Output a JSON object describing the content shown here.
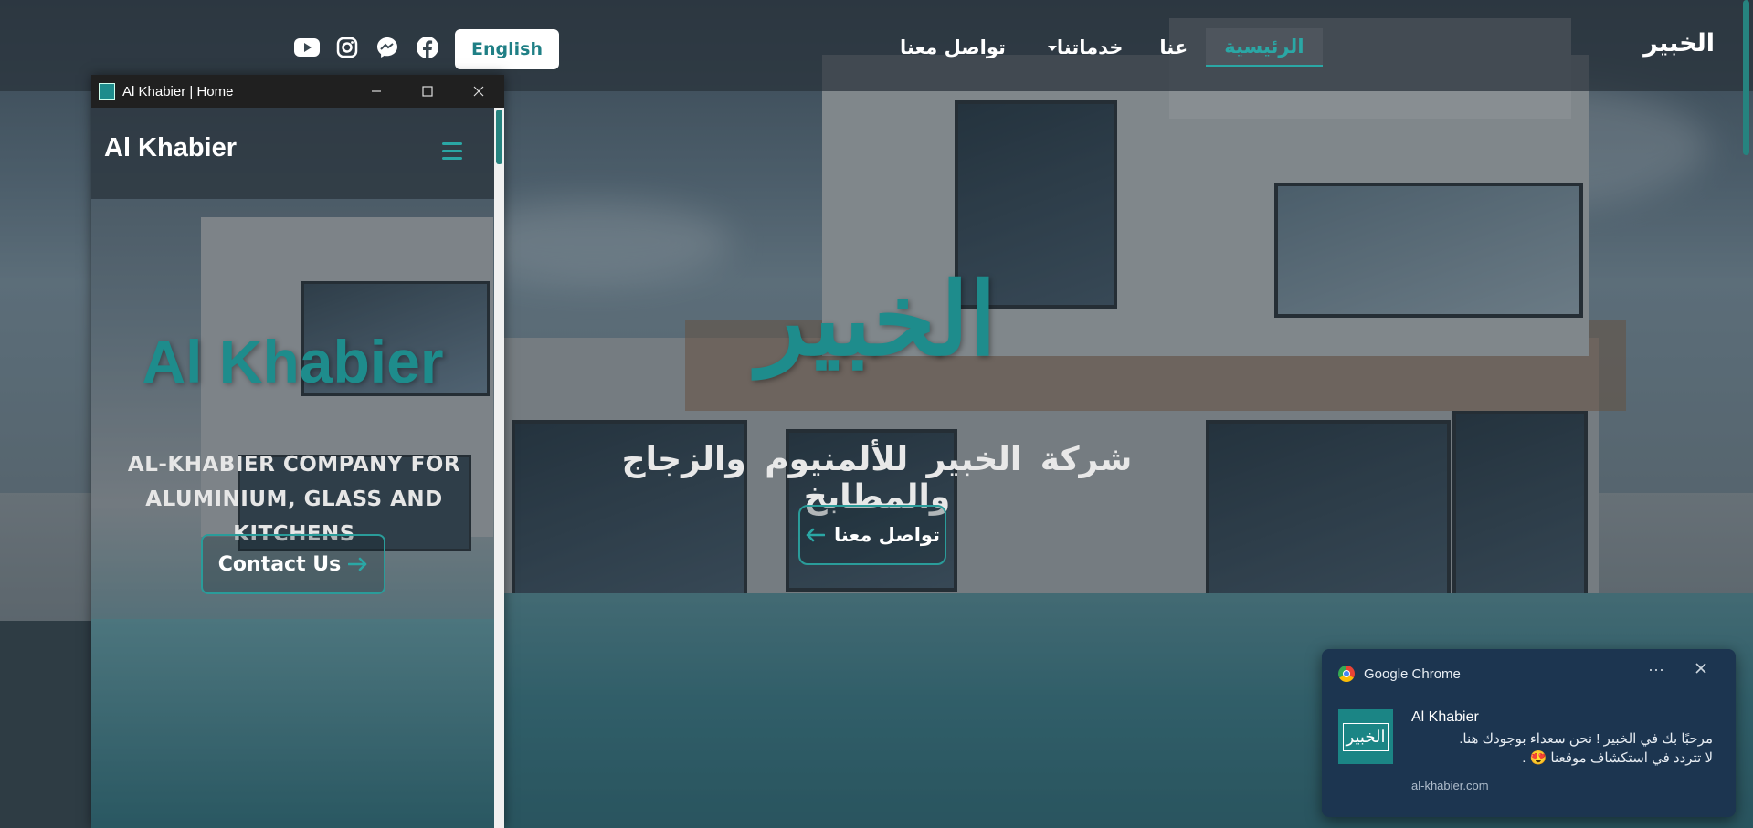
{
  "desktop": {
    "brand": "الخبير",
    "nav": [
      {
        "label": "الرئيسية",
        "active": true
      },
      {
        "label": "عنا",
        "active": false
      },
      {
        "label": "خدماتنا",
        "active": false,
        "dropdown": true
      },
      {
        "label": "تواصل معنا",
        "active": false
      }
    ],
    "language_button": "English",
    "socials": [
      "youtube-icon",
      "instagram-icon",
      "messenger-icon",
      "facebook-icon"
    ],
    "hero": {
      "title": "الخبير",
      "subtitle": "شركة الخبير للألمنيوم والزجاج والمطابخ",
      "cta": "تواصل معنا"
    }
  },
  "window": {
    "title": "Al Khabier | Home",
    "controls": [
      "minimize",
      "maximize",
      "close"
    ]
  },
  "mobile": {
    "brand": "Al Khabier",
    "hero_title": "Al Khabier",
    "subtitle_line1": "AL-KHABIER COMPANY FOR",
    "subtitle_line2": "ALUMINIUM, GLASS AND KITCHENS",
    "cta": "Contact Us"
  },
  "notification": {
    "app": "Google Chrome",
    "more": "···",
    "sender": "Al Khabier",
    "message_line1": "مرحبًا بك في الخبير ! نحن سعداء بوجودك هنا.",
    "message_line2": "لا تتردد في استكشاف موقعنا 😍 .",
    "site": "al-khabier.com",
    "logo_text": "الخبير"
  },
  "colors": {
    "accent": "#1e8c8c",
    "nav_bg": "#28323a",
    "toast_bg": "#1c3550"
  }
}
